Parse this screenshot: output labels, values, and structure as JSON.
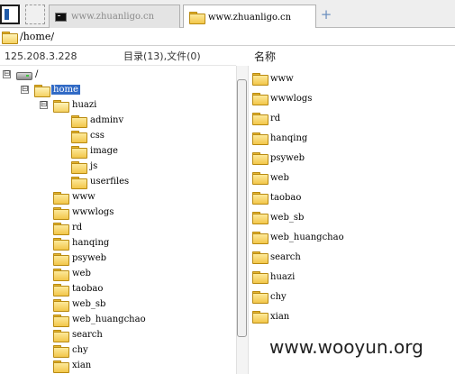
{
  "tabs": [
    {
      "label": "www.zhuanligo.cn",
      "icon": "terminal-icon",
      "active": false
    },
    {
      "label": "www.zhuanligo.cn",
      "icon": "folder-icon",
      "active": true
    }
  ],
  "add_tab": "+",
  "path": "/home/",
  "headers": {
    "ip": "125.208.3.228",
    "summary": "目录(13),文件(0)",
    "name": "名称"
  },
  "tree": [
    {
      "label": "/",
      "icon": "drive-icon",
      "expander": "⊟"
    },
    {
      "label": "home",
      "icon": "folder-open-icon",
      "expander": "⊟",
      "selected": true
    },
    {
      "label": "huazi",
      "icon": "folder-open-icon",
      "expander": "⊟"
    },
    {
      "label": "adminv",
      "icon": "folder-icon"
    },
    {
      "label": "css",
      "icon": "folder-icon"
    },
    {
      "label": "image",
      "icon": "folder-icon"
    },
    {
      "label": "js",
      "icon": "folder-icon"
    },
    {
      "label": "userfiles",
      "icon": "folder-icon"
    },
    {
      "label": "www",
      "icon": "folder-icon"
    },
    {
      "label": "wwwlogs",
      "icon": "folder-icon"
    },
    {
      "label": "rd",
      "icon": "folder-icon"
    },
    {
      "label": "hanqing",
      "icon": "folder-icon"
    },
    {
      "label": "psyweb",
      "icon": "folder-icon"
    },
    {
      "label": "web",
      "icon": "folder-icon"
    },
    {
      "label": "taobao",
      "icon": "folder-icon"
    },
    {
      "label": "web_sb",
      "icon": "folder-icon"
    },
    {
      "label": "web_huangchao",
      "icon": "folder-icon"
    },
    {
      "label": "search",
      "icon": "folder-icon"
    },
    {
      "label": "chy",
      "icon": "folder-icon"
    },
    {
      "label": "xian",
      "icon": "folder-icon"
    }
  ],
  "files": [
    "www",
    "wwwlogs",
    "rd",
    "hanqing",
    "psyweb",
    "web",
    "taobao",
    "web_sb",
    "web_huangchao",
    "search",
    "huazi",
    "chy",
    "xian"
  ],
  "watermark": "www.wooyun.org",
  "colors": {
    "selection": "#316ac5",
    "folder": "#f2c64a"
  }
}
